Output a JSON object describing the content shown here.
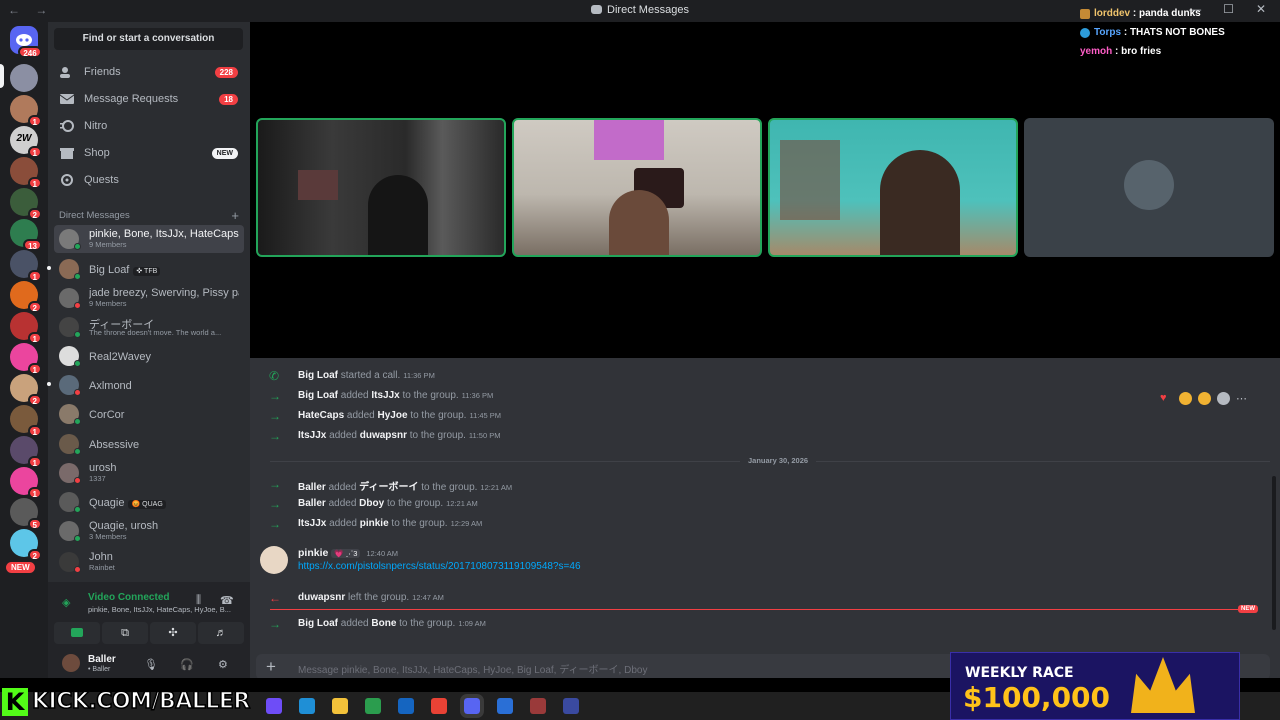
{
  "titlebar": {
    "title": "Direct Messages",
    "nav": "← →",
    "min": "—",
    "max": "☐",
    "close": "✕"
  },
  "overlay_chat": [
    {
      "user": "lorddev",
      "text": "panda dunks",
      "color": "#f0c46c"
    },
    {
      "user": "Torps",
      "text": "THATS NOT BONES",
      "color": "#58a6ff"
    },
    {
      "user": "yemoh",
      "text": "bro fries",
      "color": "#ff5ec8"
    }
  ],
  "rail": {
    "home_badge": "246",
    "servers": [
      {
        "badge": "",
        "color": "#8b8fa3"
      },
      {
        "badge": "1",
        "color": "#b07a5c"
      },
      {
        "badge": "1",
        "color": "#cfcfcf",
        "label": "2W"
      },
      {
        "badge": "1",
        "color": "#8a4d3a"
      },
      {
        "badge": "2",
        "color": "#3b5d3b"
      },
      {
        "badge": "13",
        "color": "#2e7d4f"
      },
      {
        "badge": "1",
        "color": "#4a5266"
      },
      {
        "badge": "2",
        "color": "#e06a1d"
      },
      {
        "badge": "1",
        "color": "#b83232"
      },
      {
        "badge": "1",
        "color": "#eb459e"
      },
      {
        "badge": "2",
        "color": "#c9a27c"
      },
      {
        "badge": "1",
        "color": "#7a5a3c"
      },
      {
        "badge": "1",
        "color": "#5a4a6a"
      },
      {
        "badge": "1",
        "color": "#eb459e"
      },
      {
        "badge": "5",
        "color": "#5a5a5a"
      },
      {
        "badge": "2",
        "color": "#5dc6e8"
      }
    ],
    "new_label": "NEW"
  },
  "sidebar": {
    "search_placeholder": "Find or start a conversation",
    "nav": [
      {
        "label": "Friends",
        "count": "228"
      },
      {
        "label": "Message Requests",
        "count": "18"
      },
      {
        "label": "Nitro",
        "count": ""
      },
      {
        "label": "Shop",
        "count": "",
        "new": "NEW"
      },
      {
        "label": "Quests",
        "count": ""
      }
    ],
    "dm_header": "Direct Messages",
    "dms": [
      {
        "name": "pinkie, Bone, ItsJJx, HateCaps,...",
        "sub": "9 Members",
        "color": "#7a7a7a"
      },
      {
        "name": "Big Loaf",
        "tag": "✜ TFB",
        "sub": "",
        "color": "#8a6a55"
      },
      {
        "name": "jade breezy, Swerving, Pissy pa...",
        "sub": "9 Members",
        "color": "#6a6a6a"
      },
      {
        "name": "ディーボーイ",
        "sub": "The throne doesn't move. The world a...",
        "color": "#444"
      },
      {
        "name": "Real2Wavey",
        "sub": "",
        "color": "#ddd"
      },
      {
        "name": "Axlmond",
        "sub": "",
        "color": "#5a6a7a"
      },
      {
        "name": "CorCor",
        "sub": "",
        "color": "#8a7a6a"
      },
      {
        "name": "Absessive",
        "sub": "",
        "color": "#6a5a4a"
      },
      {
        "name": "urosh",
        "sub": "1337",
        "color": "#7a6a6a"
      },
      {
        "name": "Quagie",
        "tag": "😡 QUAG",
        "sub": "",
        "color": "#5a5a5a"
      },
      {
        "name": "Quagie, urosh",
        "sub": "3 Members",
        "color": "#6a6a6a"
      },
      {
        "name": "John",
        "sub": "Rainbet",
        "color": "#3a3a3a"
      }
    ]
  },
  "voice": {
    "status": "Video Connected",
    "members": "pinkie, Bone, ItsJJx, HateCaps, HyJoe, B...",
    "user_name": "Baller",
    "user_status": "• Baller"
  },
  "chat": {
    "events": [
      {
        "actor": "Big Loaf",
        "verb": "started a call.",
        "target": "",
        "tail": "",
        "ts": "11:36 PM",
        "kind": "call"
      },
      {
        "actor": "Big Loaf",
        "verb": "added",
        "target": "ItsJJx",
        "tail": "to the group.",
        "ts": "11:36 PM",
        "kind": "join"
      },
      {
        "actor": "HateCaps",
        "verb": "added",
        "target": "HyJoe",
        "tail": "to the group.",
        "ts": "11:45 PM",
        "kind": "join"
      },
      {
        "actor": "ItsJJx",
        "verb": "added",
        "target": "duwapsnr",
        "tail": "to the group.",
        "ts": "11:50 PM",
        "kind": "join"
      }
    ],
    "date_divider": "January 30, 2026",
    "events2": [
      {
        "actor": "Baller",
        "verb": "added",
        "target": "ディーボーイ",
        "tail": "to the group.",
        "ts": "12:21 AM"
      },
      {
        "actor": "Baller",
        "verb": "added",
        "target": "Dboy",
        "tail": "to the group.",
        "ts": "12:21 AM"
      },
      {
        "actor": "ItsJJx",
        "verb": "added",
        "target": "pinkie",
        "tail": "to the group.",
        "ts": "12:29 AM"
      }
    ],
    "message": {
      "author": "pinkie",
      "badge": "💗 ⋰3",
      "ts": "12:40 AM",
      "link": "https://x.com/pistolsnpercs/status/2017108073119109548?s=46"
    },
    "leave": {
      "actor": "duwapsnr",
      "verb": "left the group.",
      "ts": "12:47 AM"
    },
    "new_label": "NEW",
    "last": {
      "actor": "Big Loaf",
      "verb": "added",
      "target": "Bone",
      "tail": "to the group.",
      "ts": "1:09 AM"
    },
    "composer_placeholder": "Message pinkie, Bone, ItsJJx, HateCaps, HyJoe, Big Loaf, ディーボーイ, Dboy"
  },
  "promo": {
    "kick_url": "KICK.COM/BALLER",
    "race_title": "WEEKLY RACE",
    "race_amount": "$100,000"
  },
  "taskbar": {
    "icons": [
      "copilot-icon",
      "edge-icon",
      "files-icon",
      "store-icon",
      "outlook-icon",
      "chrome-icon",
      "discord-icon",
      "remote-icon",
      "obs-icon",
      "app-icon"
    ]
  }
}
